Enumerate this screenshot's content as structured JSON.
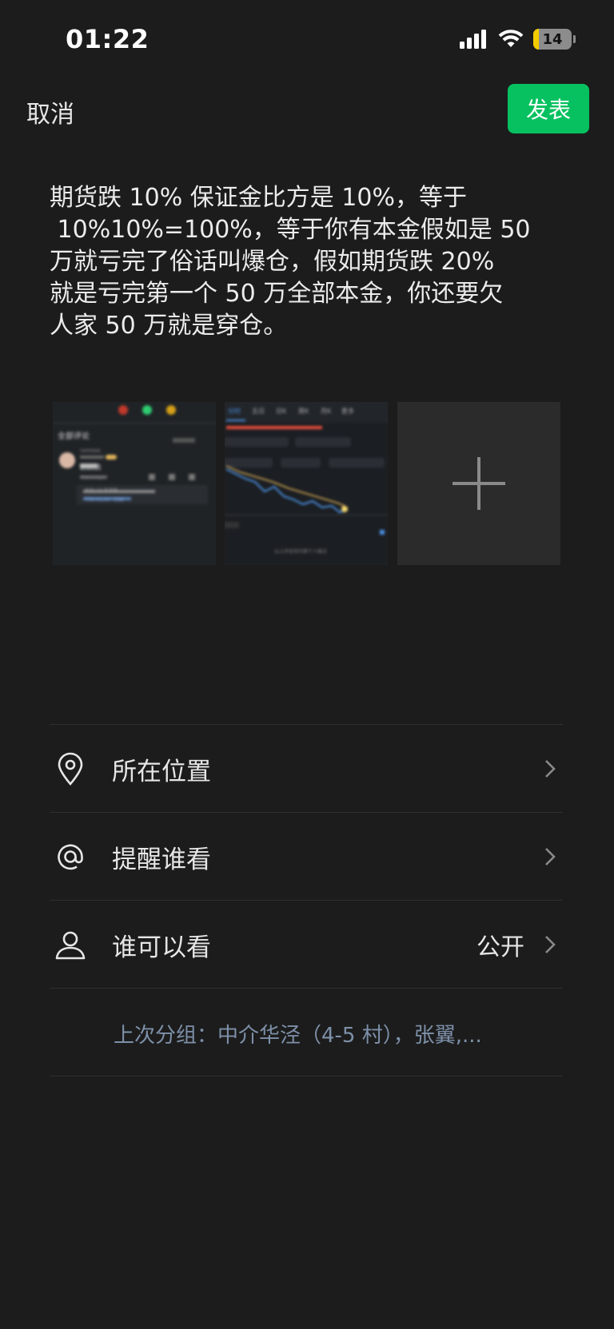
{
  "status_bar": {
    "time": "01:22",
    "battery_level": "14",
    "battery_fill": 0.14,
    "icons": [
      "signal-icon",
      "wifi-icon",
      "battery-icon"
    ]
  },
  "header": {
    "cancel_label": "取消",
    "publish_label": "发表",
    "publish_color": "#07c160"
  },
  "post": {
    "text": "期货跌 10% 保证金比方是 10%，等于\n 10%10%=100%，等于你有本金假如是 50\n万就亏完了俗话叫爆仓，假如期货跌 20%\n就是亏完第一个 50 万全部本金，你还要欠\n人家 50 万就是穿仓。"
  },
  "images": {
    "thumb1": {
      "title": "全部评论",
      "user": "SAMANA",
      "reply": "跌跌跌",
      "time": "今天 04:24",
      "reply_preview": "共有 18 条回复",
      "reply_meta": "今天 01:20 · 回复"
    },
    "thumb2": {
      "tabs": [
        "分时",
        "五日",
        "日K",
        "周K",
        "月K",
        "更多"
      ],
      "footer": "以上评论仅代表个人观点"
    },
    "add_icon": "plus-icon"
  },
  "options": [
    {
      "icon": "location-pin-icon",
      "label": "所在位置",
      "value": ""
    },
    {
      "icon": "at-sign-icon",
      "label": "提醒谁看",
      "value": ""
    },
    {
      "icon": "person-icon",
      "label": "谁可以看",
      "value": "公开"
    }
  ],
  "last_group": "上次分组：中介华泾（4-5 村），张翼,..."
}
